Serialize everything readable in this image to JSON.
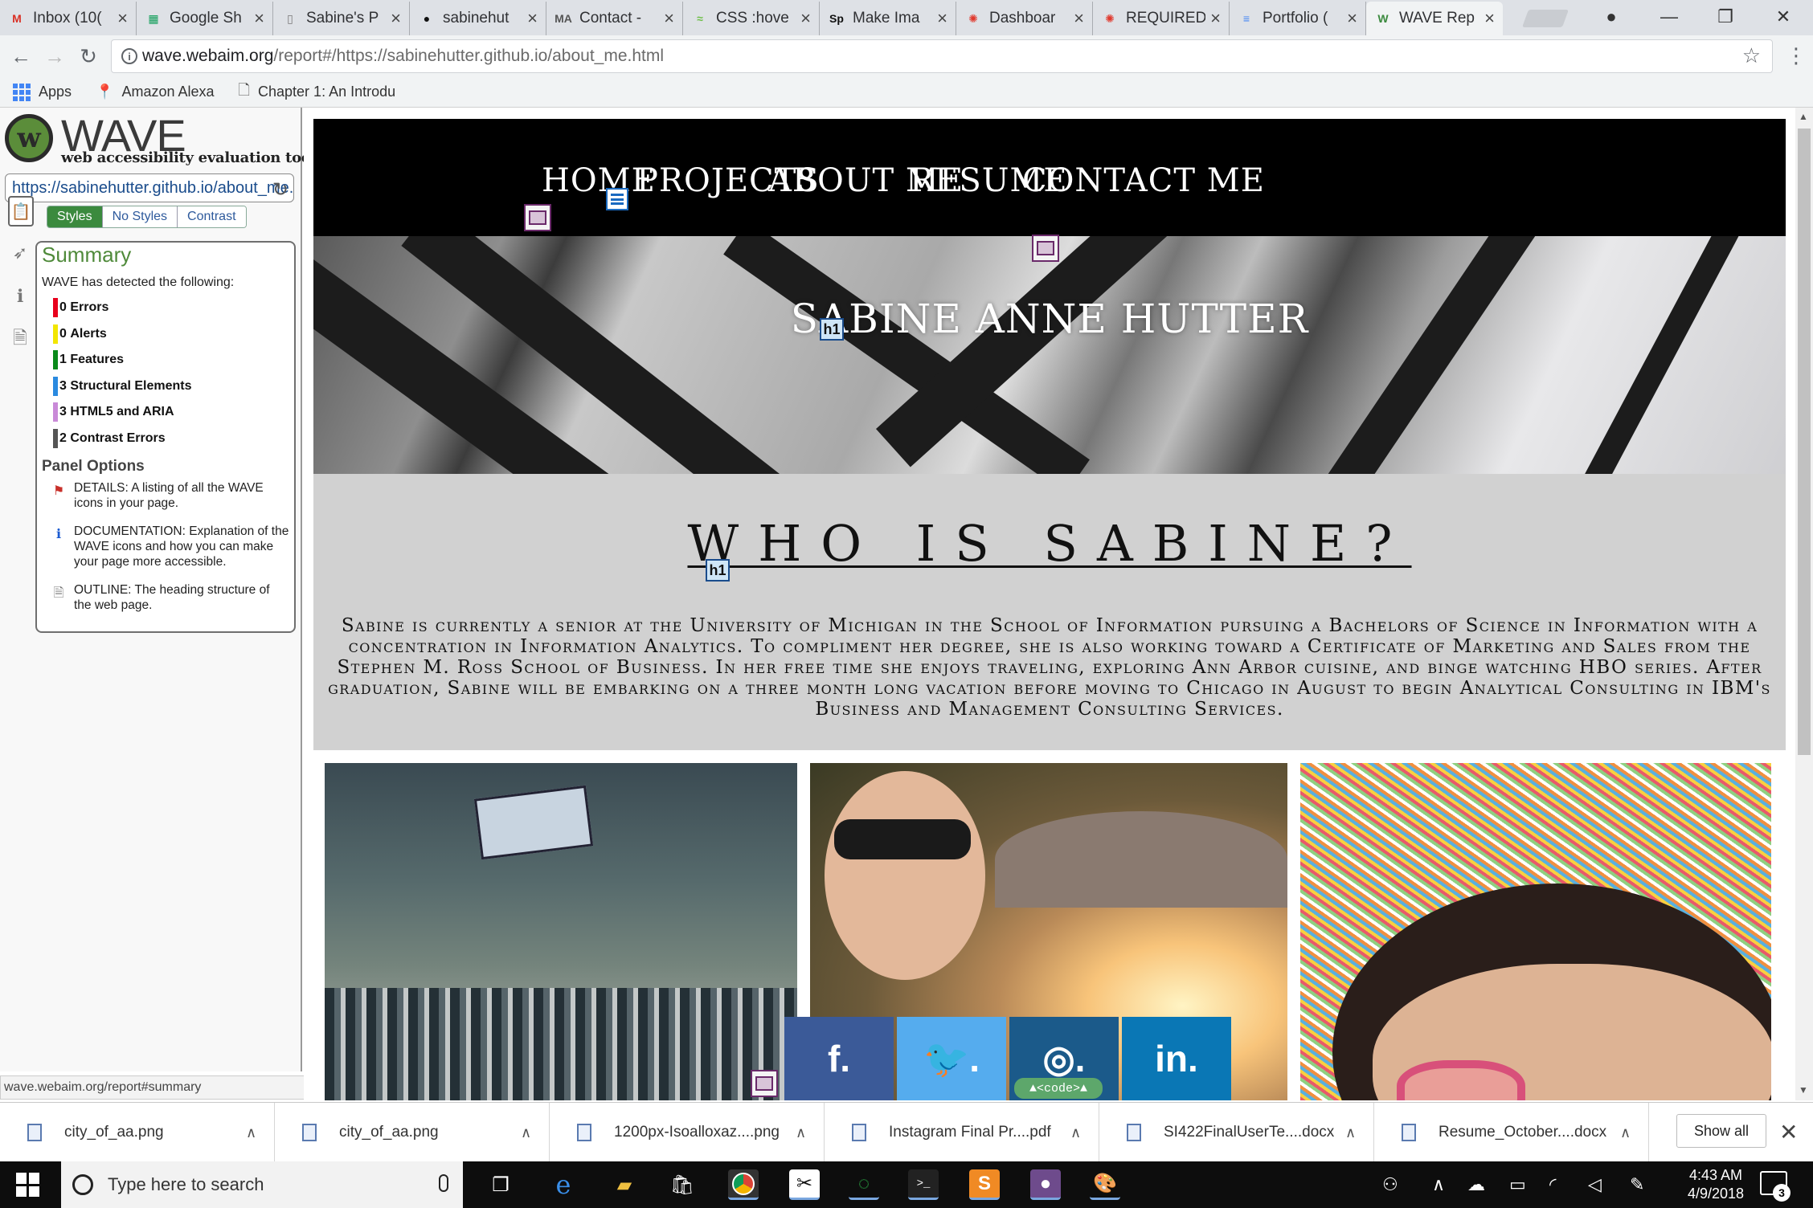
{
  "browser": {
    "tabs": [
      {
        "label": "Inbox (10(",
        "favicon": "gmail-icon",
        "color": "#d93025",
        "glyph": "M"
      },
      {
        "label": "Google Sh",
        "favicon": "sheets-icon",
        "color": "#0f9d58",
        "glyph": "▦"
      },
      {
        "label": "Sabine's P",
        "favicon": "page-icon",
        "color": "#777777",
        "glyph": "▯"
      },
      {
        "label": "sabinehut",
        "favicon": "github-icon",
        "color": "#111111",
        "glyph": "●"
      },
      {
        "label": "Contact -",
        "favicon": "ma-icon",
        "color": "#555555",
        "glyph": "MA"
      },
      {
        "label": "CSS :hove",
        "favicon": "css-icon",
        "color": "#6fbf4a",
        "glyph": "≈"
      },
      {
        "label": "Make Ima",
        "favicon": "sp-icon",
        "color": "#111111",
        "glyph": "Sp"
      },
      {
        "label": "Dashboar",
        "favicon": "canvas-icon",
        "color": "#e0392d",
        "glyph": "✺"
      },
      {
        "label": "REQUIRED",
        "favicon": "canvas-icon",
        "color": "#e0392d",
        "glyph": "✺"
      },
      {
        "label": "Portfolio (",
        "favicon": "docs-icon",
        "color": "#4285f4",
        "glyph": "≡"
      },
      {
        "label": "WAVE Rep",
        "favicon": "wave-icon",
        "color": "#3b8a3e",
        "glyph": "W"
      }
    ],
    "url_host": "wave.webaim.org",
    "url_path": "/report#/https://sabinehutter.github.io/about_me.html",
    "bookmarks": [
      {
        "label": "Apps",
        "icon": "apps-grid-icon"
      },
      {
        "label": "Amazon Alexa",
        "icon": "map-pin-icon"
      },
      {
        "label": "Chapter 1: An Introdu",
        "icon": "page-icon"
      }
    ]
  },
  "wave": {
    "title": "WAVE",
    "tagline": "web accessibility evaluation tool",
    "url_value": "https://sabinehutter.github.io/about_me.html",
    "view_buttons": [
      "Styles",
      "No Styles",
      "Contrast"
    ],
    "summary_title": "Summary",
    "summary_intro": "WAVE has detected the following:",
    "rows": [
      {
        "count": "0",
        "label": "Errors",
        "color": "#e8001c"
      },
      {
        "count": "0",
        "label": "Alerts",
        "color": "#f2e600"
      },
      {
        "count": "1",
        "label": "Features",
        "color": "#0a8a1a"
      },
      {
        "count": "3",
        "label": "Structural Elements",
        "color": "#2a8ae0"
      },
      {
        "count": "3",
        "label": "HTML5 and ARIA",
        "color": "#c98ad8"
      },
      {
        "count": "2",
        "label": "Contrast Errors",
        "color": "#555555"
      }
    ],
    "panel_options_title": "Panel Options",
    "panel_options": [
      {
        "text": "DETAILS: A listing of all the WAVE icons in your page.",
        "icon": "flag-icon"
      },
      {
        "text": "DOCUMENTATION: Explanation of the WAVE icons and how you can make your page more accessible.",
        "icon": "info-icon"
      },
      {
        "text": "OUTLINE: The heading structure of the web page.",
        "icon": "outline-page-icon"
      }
    ],
    "status_url": "wave.webaim.org/report#summary"
  },
  "site": {
    "nav": [
      "HOME",
      "PROJECTS",
      "ABOUT ME",
      "RESUME",
      "CONTACT ME"
    ],
    "hero_name": "SABINE ANNE HUTTER",
    "about_heading": "WHO IS SABINE?",
    "about_text": "Sabine is currently a senior at the University of Michigan in the School of Information pursuing a Bachelors of Science in Information with a concentration in Information Analytics. To compliment her degree, she is also working toward a Certificate of Marketing and Sales from the Stephen M. Ross School of Business. In her free time she enjoys traveling, exploring Ann Arbor cuisine, and binge watching HBO series. After graduation, Sabine will be embarking on a three month long vacation before moving to Chicago in August to begin Analytical Consulting in IBM's Business and Management Consulting Services.",
    "social": [
      {
        "label": "f.",
        "name": "facebook-link",
        "color": "#3b5a98"
      },
      {
        "label": "🐦.",
        "name": "twitter-link",
        "color": "#55acee"
      },
      {
        "label": "◎.",
        "name": "instagram-link",
        "color": "#1b5a8a"
      },
      {
        "label": "in.",
        "name": "linkedin-link",
        "color": "#0a77b5"
      }
    ],
    "h1_badge": "h1",
    "code_badge": "▲<code>▲"
  },
  "downloads": {
    "items": [
      "city_of_aa.png",
      "city_of_aa.png",
      "1200px-Isoalloxaz....png",
      "Instagram Final Pr....pdf",
      "SI422FinalUserTe....docx",
      "Resume_October....docx"
    ],
    "show_all": "Show all"
  },
  "taskbar": {
    "search_placeholder": "Type here to search",
    "time": "4:43 AM",
    "date": "4/9/2018",
    "notifications": "3"
  }
}
